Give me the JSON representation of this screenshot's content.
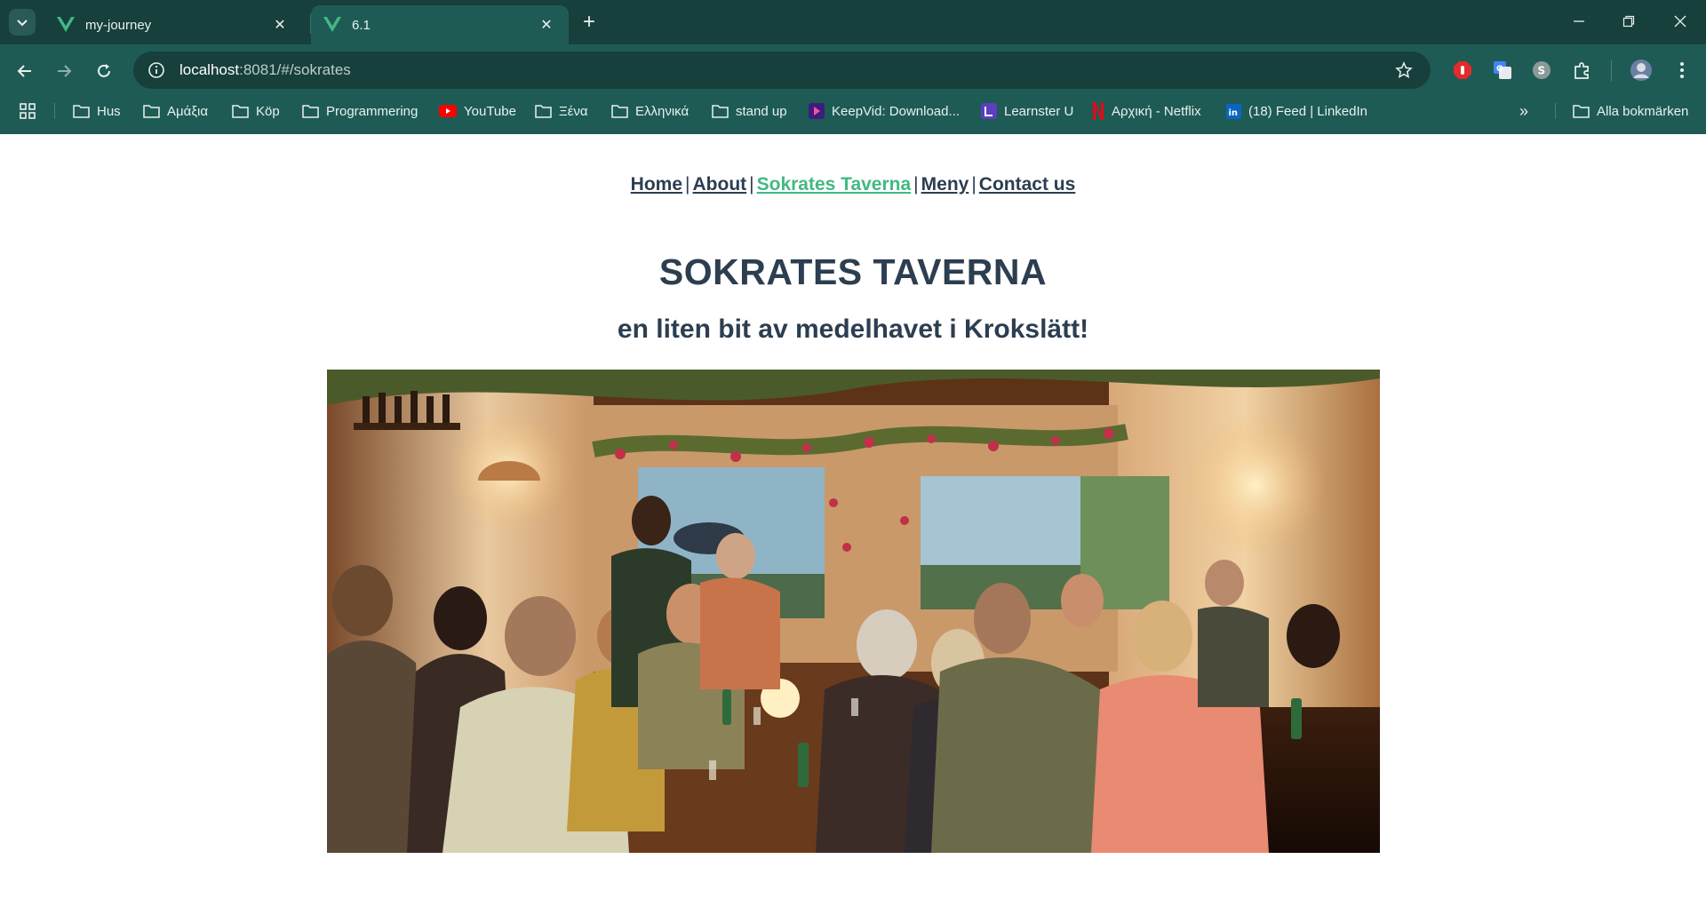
{
  "browser": {
    "tabs": [
      {
        "title": "my-journey",
        "active": false
      },
      {
        "title": "6.1",
        "active": true
      }
    ],
    "url_host": "localhost",
    "url_path": ":8081/#/sokrates",
    "bookmarks": [
      {
        "label": "Hus",
        "icon": "folder-icon"
      },
      {
        "label": "Αμάξια",
        "icon": "folder-icon"
      },
      {
        "label": "Köp",
        "icon": "folder-icon"
      },
      {
        "label": "Programmering",
        "icon": "folder-icon"
      },
      {
        "label": "YouTube",
        "icon": "youtube-icon"
      },
      {
        "label": "Ξένα",
        "icon": "folder-icon"
      },
      {
        "label": "Ελληνικά",
        "icon": "folder-icon"
      },
      {
        "label": "stand up",
        "icon": "folder-icon"
      },
      {
        "label": "KeepVid: Download...",
        "icon": "keepvid-icon"
      },
      {
        "label": "Learnster U",
        "icon": "learnster-icon"
      },
      {
        "label": "Αρχική - Netflix",
        "icon": "netflix-icon"
      },
      {
        "label": "(18) Feed | LinkedIn",
        "icon": "linkedin-icon"
      }
    ],
    "all_bookmarks": "Alla bokmärken",
    "more_bookmarks": "»",
    "accent": "#1f5b55"
  },
  "site": {
    "nav": [
      {
        "label": "Home",
        "active": false
      },
      {
        "label": "About",
        "active": false
      },
      {
        "label": "Sokrates Taverna",
        "active": true
      },
      {
        "label": "Meny",
        "active": false
      },
      {
        "label": "Contact us",
        "active": false
      }
    ],
    "nav_separator": "|",
    "title": "SOKRATES TAVERNA",
    "subtitle": "en liten bit av medelhavet i Krokslätt!",
    "text_color": "#2c3e50",
    "active_color": "#42b983"
  }
}
